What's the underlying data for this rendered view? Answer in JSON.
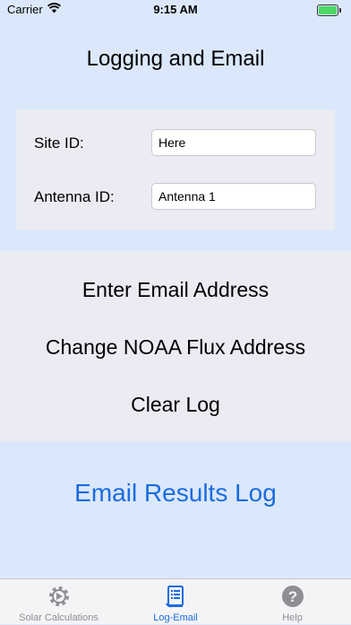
{
  "status_bar": {
    "carrier": "Carrier",
    "time": "9:15 AM",
    "battery_level": 1.0
  },
  "page_title": "Logging and Email",
  "site_id": {
    "label": "Site ID:",
    "value": "Here"
  },
  "antenna_id": {
    "label": "Antenna ID:",
    "value": "Antenna 1"
  },
  "actions": {
    "enter_email": "Enter Email Address",
    "change_noaa": "Change NOAA Flux Address",
    "clear_log": "Clear Log"
  },
  "email_results": "Email Results Log",
  "tabs": [
    {
      "label": "Solar Calculations",
      "icon": "gear-icon",
      "active": false
    },
    {
      "label": "Log-Email",
      "icon": "log-document-icon",
      "active": true
    },
    {
      "label": "Help",
      "icon": "help-icon",
      "active": false
    }
  ],
  "colors": {
    "background": "#dbe8fb",
    "panel": "#ebebf3",
    "accent": "#1a6ce0",
    "inactive_tab": "#8e8e93"
  }
}
